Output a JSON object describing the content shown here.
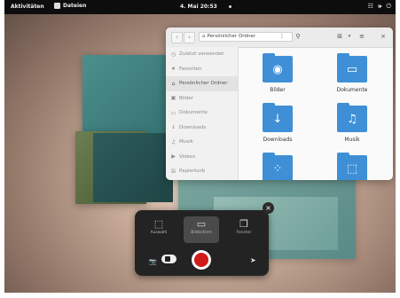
{
  "topbar": {
    "activities": "Aktivitäten",
    "app_name": "Dateien",
    "clock": "4. Mai 20:53",
    "tray_icons": [
      "network-icon",
      "volume-icon",
      "power-icon"
    ]
  },
  "file_manager": {
    "path": "Persönlicher Ordner",
    "sidebar": [
      {
        "label": "Zuletzt verwendet",
        "icon": "clock-icon"
      },
      {
        "label": "Favoriten",
        "icon": "star-icon"
      },
      {
        "label": "Persönlicher Ordner",
        "icon": "home-icon",
        "active": true
      },
      {
        "label": "Bilder",
        "icon": "image-icon"
      },
      {
        "label": "Dokumente",
        "icon": "document-icon"
      },
      {
        "label": "Downloads",
        "icon": "download-icon"
      },
      {
        "label": "Musik",
        "icon": "music-icon"
      },
      {
        "label": "Videos",
        "icon": "video-icon"
      },
      {
        "label": "Papierkorb",
        "icon": "trash-icon"
      }
    ],
    "folders": [
      {
        "label": "Bilder",
        "icon": "camera-icon"
      },
      {
        "label": "Dokumente",
        "icon": "document-icon"
      },
      {
        "label": "Downloads",
        "icon": "download-icon"
      },
      {
        "label": "Musik",
        "icon": "music-icon"
      },
      {
        "label": "",
        "icon": "share-icon"
      },
      {
        "label": "",
        "icon": "template-icon"
      }
    ]
  },
  "screenshot_panel": {
    "modes": [
      {
        "label": "Auswahl",
        "icon": "selection-icon"
      },
      {
        "label": "Bildschirm",
        "icon": "monitor-icon",
        "selected": true
      },
      {
        "label": "Fenster",
        "icon": "window-icon"
      }
    ]
  },
  "colors": {
    "accent": "#3e8fd6",
    "shutter": "#d01b1b",
    "topbar": "#0d0d0d",
    "panel": "#232323"
  }
}
